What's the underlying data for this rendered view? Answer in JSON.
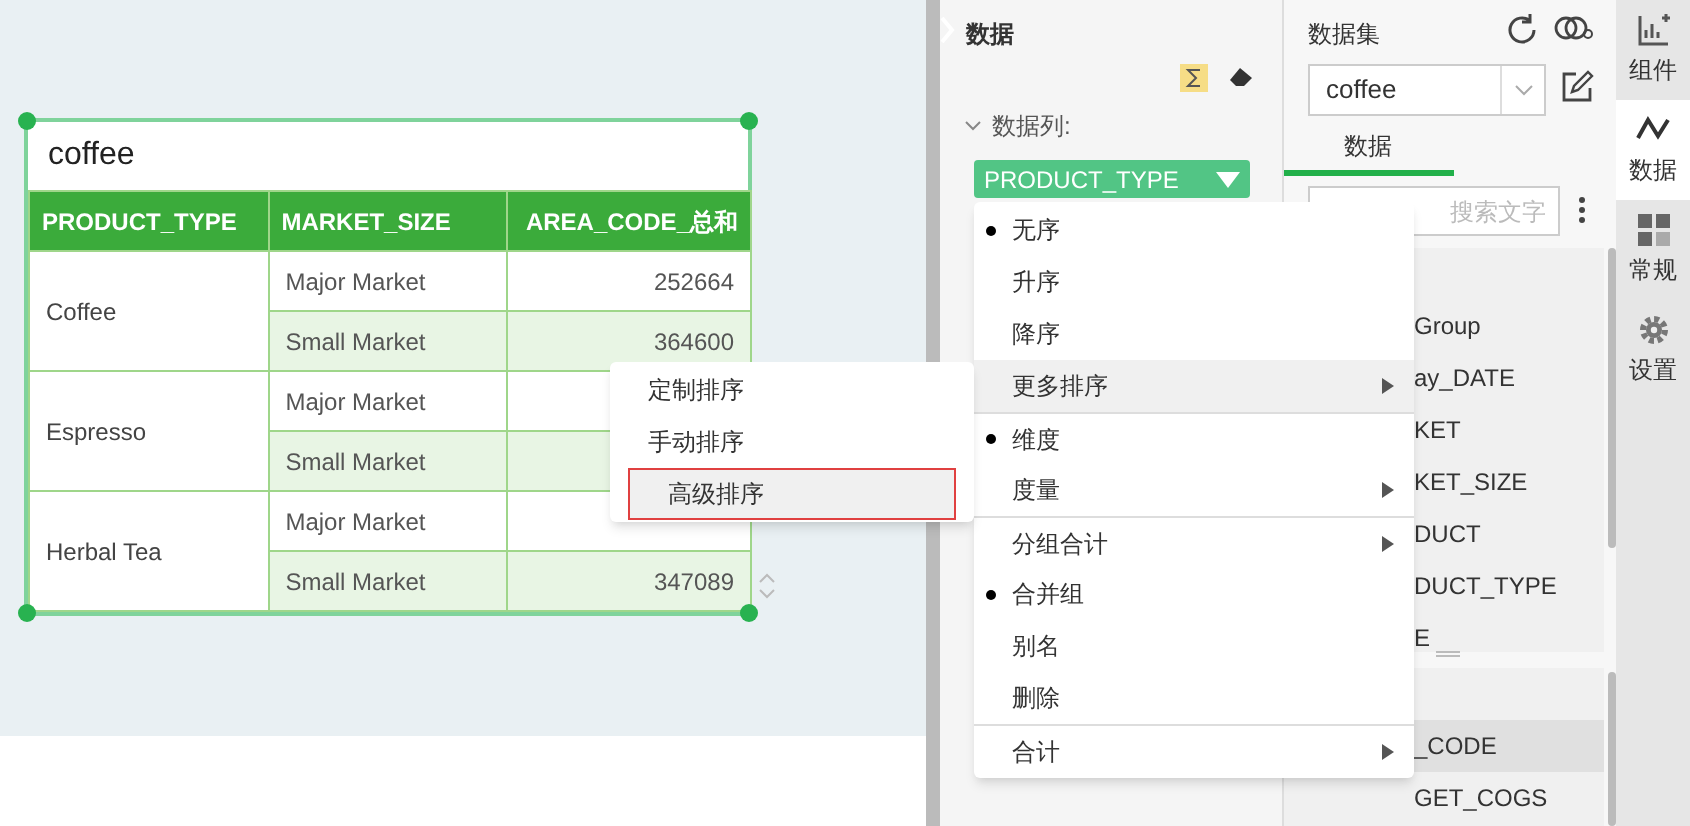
{
  "widget": {
    "title": "coffee",
    "columns": [
      "PRODUCT_TYPE",
      "MARKET_SIZE",
      "AREA_CODE_总和"
    ],
    "groups": [
      {
        "product": "Coffee",
        "rows": [
          {
            "market": "Major Market",
            "value": "252664"
          },
          {
            "market": "Small Market",
            "value": "364600"
          }
        ]
      },
      {
        "product": "Espresso",
        "rows": [
          {
            "market": "Major Market"
          },
          {
            "market": "Small Market"
          }
        ]
      },
      {
        "product": "Herbal Tea",
        "rows": [
          {
            "market": "Major Market"
          },
          {
            "market": "Small Market",
            "value": "347089"
          }
        ]
      }
    ]
  },
  "data_panel": {
    "title": "数据",
    "section": "数据列:",
    "field_pill": "PRODUCT_TYPE"
  },
  "context_menu": [
    {
      "label": "无序",
      "selected": true,
      "has_submenu": false,
      "highlighted": false,
      "divider_before": false
    },
    {
      "label": "升序",
      "selected": false,
      "has_submenu": false,
      "highlighted": false,
      "divider_before": false
    },
    {
      "label": "降序",
      "selected": false,
      "has_submenu": false,
      "highlighted": false,
      "divider_before": false
    },
    {
      "label": "更多排序",
      "selected": false,
      "has_submenu": true,
      "highlighted": true,
      "divider_before": false
    },
    {
      "label": "维度",
      "selected": true,
      "has_submenu": false,
      "highlighted": false,
      "divider_before": true
    },
    {
      "label": "度量",
      "selected": false,
      "has_submenu": true,
      "highlighted": false,
      "divider_before": false
    },
    {
      "label": "分组合计",
      "selected": false,
      "has_submenu": true,
      "highlighted": false,
      "divider_before": true
    },
    {
      "label": "合并组",
      "selected": true,
      "has_submenu": false,
      "highlighted": false,
      "divider_before": false
    },
    {
      "label": "别名",
      "selected": false,
      "has_submenu": false,
      "highlighted": false,
      "divider_before": false
    },
    {
      "label": "删除",
      "selected": false,
      "has_submenu": false,
      "highlighted": false,
      "divider_before": false
    },
    {
      "label": "合计",
      "selected": false,
      "has_submenu": true,
      "highlighted": false,
      "divider_before": true
    }
  ],
  "submenu": [
    {
      "label": "定制排序",
      "highlighted": false
    },
    {
      "label": "手动排序",
      "highlighted": false
    },
    {
      "label": "高级排序",
      "highlighted": true
    }
  ],
  "dataset_panel": {
    "title": "数据集",
    "dataset": "coffee",
    "tab": "数据",
    "search_placeholder": "搜索文字",
    "fields": [
      {
        "label": "Group",
        "selected": false
      },
      {
        "label": "ay_DATE",
        "selected": false
      },
      {
        "label": "KET",
        "selected": false
      },
      {
        "label": "KET_SIZE",
        "selected": false
      },
      {
        "label": "DUCT",
        "selected": false
      },
      {
        "label": "DUCT_TYPE",
        "selected": false
      },
      {
        "label": "E",
        "selected": false
      }
    ],
    "measures": [
      {
        "label": "_CODE",
        "selected": true
      },
      {
        "label": "GET_COGS",
        "selected": false
      }
    ]
  },
  "side_tabs": [
    {
      "label": "组件",
      "kind": "chart",
      "selected": false
    },
    {
      "label": "数据",
      "kind": "line",
      "selected": true
    },
    {
      "label": "常规",
      "kind": "grid",
      "selected": false
    },
    {
      "label": "设置",
      "kind": "gear",
      "selected": false
    }
  ]
}
